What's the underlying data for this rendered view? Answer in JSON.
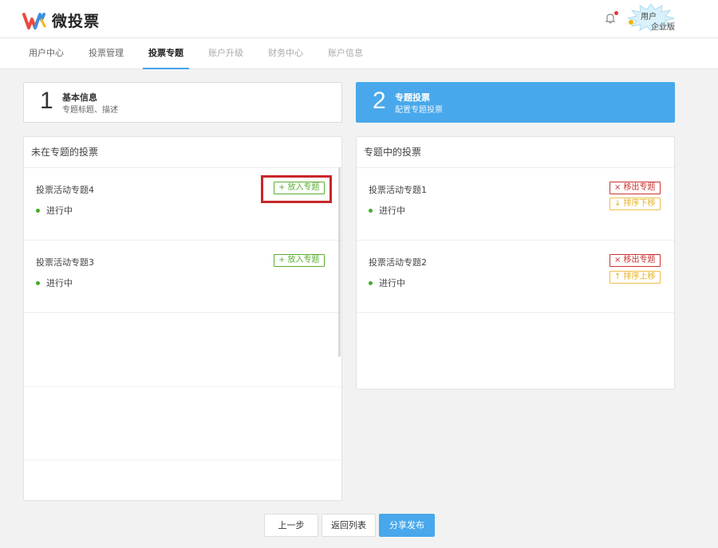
{
  "header": {
    "logo_text": "微投票",
    "user": {
      "name": "用户",
      "level": "企业版"
    }
  },
  "nav": {
    "items": [
      {
        "label": "用户中心"
      },
      {
        "label": "投票管理"
      },
      {
        "label": "投票专题"
      },
      {
        "label": "账户升级"
      },
      {
        "label": "财务中心"
      },
      {
        "label": "账户信息"
      }
    ]
  },
  "steps": [
    {
      "number": "1",
      "title": "基本信息",
      "desc": "专题标题、描述"
    },
    {
      "number": "2",
      "title": "专题投票",
      "desc": "配置专题投票"
    }
  ],
  "left_panel": {
    "title": "未在专题的投票",
    "items": [
      {
        "name": "投票活动专题4",
        "status": "进行中",
        "action": "+ 放入专题"
      },
      {
        "name": "投票活动专题3",
        "status": "进行中",
        "action": "+ 放入专题"
      }
    ]
  },
  "right_panel": {
    "title": "专题中的投票",
    "items": [
      {
        "name": "投票活动专题1",
        "status": "进行中",
        "remove": "× 移出专题",
        "sort": "↓ 排序下移"
      },
      {
        "name": "投票活动专题2",
        "status": "进行中",
        "remove": "× 移出专题",
        "sort": "↑ 排序上移"
      }
    ]
  },
  "footer": {
    "prev": "上一步",
    "back": "返回列表",
    "publish": "分享发布"
  },
  "colors": {
    "accent": "#48a8eb",
    "add_green": "#5bae33",
    "remove_red": "#cc3333",
    "sort_yellow": "#e8b01c",
    "highlight_red": "#c8262b"
  }
}
